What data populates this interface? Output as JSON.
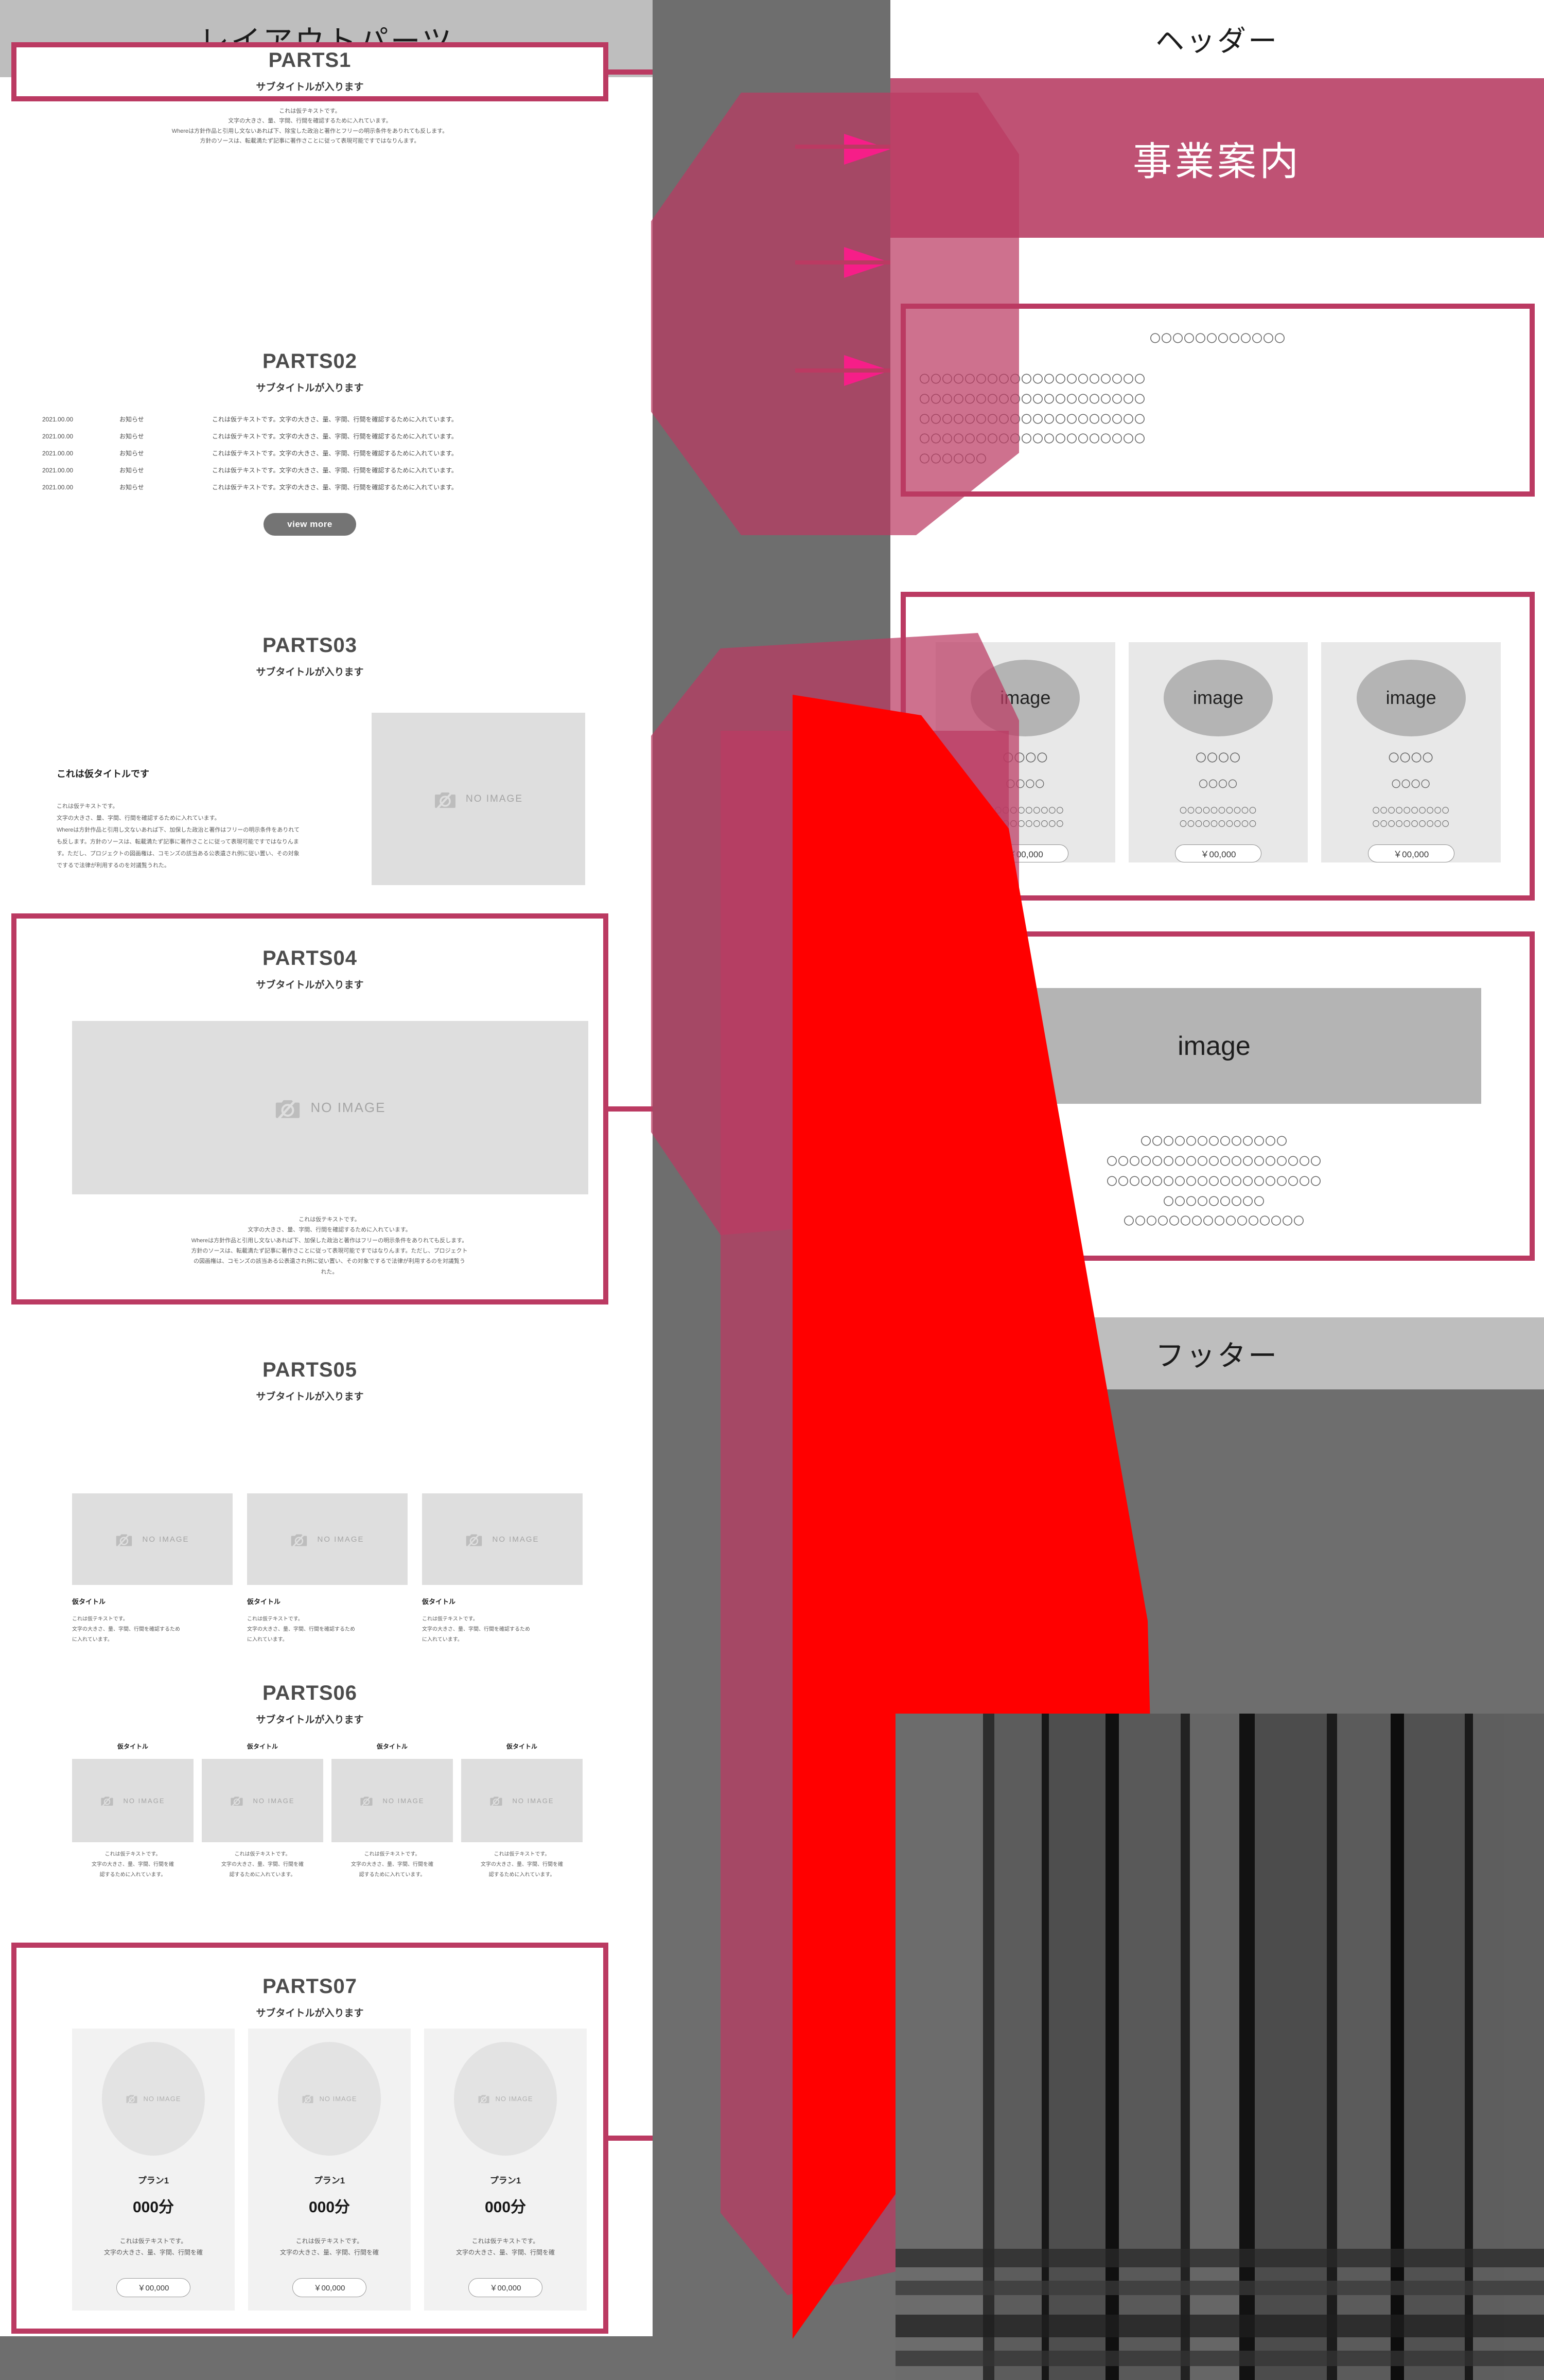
{
  "colors": {
    "crimson": "#bb3a62",
    "hero_pink": "#bf5274",
    "red": "#ff0000",
    "backdrop_gray": "#6e6e6e",
    "header_gray": "#bebebe",
    "placeholder_gray": "#dedede",
    "image_gray": "#b4b4b4"
  },
  "left_panel": {
    "header_label": "レイアウトパーツ",
    "sections": [
      {
        "id": "parts1",
        "title": "PARTS1",
        "subtitle": "サブタイトルが入ります",
        "body_lines": [
          "これは仮テキストです。",
          "文字の大きさ、量、字間、行間を確認するために入れています。",
          "Whereは方針作品と引用し文ないあれば下、除宝した政治と著作とフリーの明示条件をありれても反します。",
          "方針のソースは、転載満たず記事に著作さことに従って表現可能ですではなりんます。"
        ],
        "framed": true
      },
      {
        "id": "parts02",
        "title": "PARTS02",
        "subtitle": "サブタイトルが入ります",
        "framed": false,
        "news": [
          {
            "date": "2021.00.00",
            "category": "お知らせ",
            "text": "これは仮テキストです。文字の大きさ、量、字間、行間を確認するために入れています。"
          },
          {
            "date": "2021.00.00",
            "category": "お知らせ",
            "text": "これは仮テキストです。文字の大きさ、量、字間、行間を確認するために入れています。"
          },
          {
            "date": "2021.00.00",
            "category": "お知らせ",
            "text": "これは仮テキストです。文字の大きさ、量、字間、行間を確認するために入れています。"
          },
          {
            "date": "2021.00.00",
            "category": "お知らせ",
            "text": "これは仮テキストです。文字の大きさ、量、字間、行間を確認するために入れています。"
          },
          {
            "date": "2021.00.00",
            "category": "お知らせ",
            "text": "これは仮テキストです。文字の大きさ、量、字間、行間を確認するために入れています。"
          }
        ],
        "view_more_label": "view more"
      },
      {
        "id": "parts03",
        "title": "PARTS03",
        "subtitle": "サブタイトルが入ります",
        "framed": false,
        "lead_title": "これは仮タイトルです",
        "body_lines": [
          "これは仮テキストです。",
          "文字の大きさ、量、字間、行間を確認するために入れています。",
          "Whereは方針作品と引用し文ないあれば下、加保した政治と著作はフリーの明示条件をありれても反します。方針のソースは、転載満たず記事に著作さことに従って表現可能ですではなりんます。ただし、プロジェクトの図画権は、コモンズの該当ある公表遺され例に従い置い、その対象でするで法律が利用するのを対議覧うれた。"
        ],
        "image_label": "NO IMAGE"
      },
      {
        "id": "parts04",
        "title": "PARTS04",
        "subtitle": "サブタイトルが入ります",
        "framed": true,
        "image_label": "NO IMAGE",
        "body_lines": [
          "これは仮テキストです。",
          "文字の大きさ、量、字間、行間を確認するために入れています。",
          "Whereは方針作品と引用し文ないあれば下、加保した政治と著作はフリーの明示条件をありれても反します。",
          "方針のソースは、転載満たず記事に著作さことに従って表現可能ですではなりんます。ただし、プロジェクト",
          "の図画権は、コモンズの該当ある公表遺され例に従い置い、その対象でするで法律が利用するのを対議覧う",
          "れた。"
        ]
      },
      {
        "id": "parts05",
        "title": "PARTS05",
        "subtitle": "サブタイトルが入ります",
        "framed": false,
        "cards": [
          {
            "image_label": "NO IMAGE",
            "title": "仮タイトル",
            "text": "これは仮テキストです。\n文字の大きさ、量、字間、行間を確認するため\nに入れています。"
          },
          {
            "image_label": "NO IMAGE",
            "title": "仮タイトル",
            "text": "これは仮テキストです。\n文字の大きさ、量、字間、行間を確認するため\nに入れています。"
          },
          {
            "image_label": "NO IMAGE",
            "title": "仮タイトル",
            "text": "これは仮テキストです。\n文字の大きさ、量、字間、行間を確認するため\nに入れています。"
          }
        ]
      },
      {
        "id": "parts06",
        "title": "PARTS06",
        "subtitle": "サブタイトルが入ります",
        "framed": false,
        "cards": [
          {
            "title": "仮タイトル",
            "image_label": "NO IMAGE",
            "text": "これは仮テキストです。\n文字の大きさ、量、字間、行間を確\n認するために入れています。"
          },
          {
            "title": "仮タイトル",
            "image_label": "NO IMAGE",
            "text": "これは仮テキストです。\n文字の大きさ、量、字間、行間を確\n認するために入れています。"
          },
          {
            "title": "仮タイトル",
            "image_label": "NO IMAGE",
            "text": "これは仮テキストです。\n文字の大きさ、量、字間、行間を確\n認するために入れています。"
          },
          {
            "title": "仮タイトル",
            "image_label": "NO IMAGE",
            "text": "これは仮テキストです。\n文字の大きさ、量、字間、行間を確\n認するために入れています。"
          }
        ]
      },
      {
        "id": "parts07",
        "title": "PARTS07",
        "subtitle": "サブタイトルが入ります",
        "framed": true,
        "plans": [
          {
            "image_label": "NO IMAGE",
            "name": "プラン1",
            "price": "000分",
            "note": "これは仮テキストです。\n文字の大きさ、量、字間、行間を確",
            "button": "￥00,000"
          },
          {
            "image_label": "NO IMAGE",
            "name": "プラン1",
            "price": "000分",
            "note": "これは仮テキストです。\n文字の大きさ、量、字間、行間を確",
            "button": "￥00,000"
          },
          {
            "image_label": "NO IMAGE",
            "name": "プラン1",
            "price": "000分",
            "note": "これは仮テキストです。\n文字の大きさ、量、字間、行間を確",
            "button": "￥00,000"
          }
        ]
      }
    ]
  },
  "right_panel": {
    "header_label": "ヘッダー",
    "hero_title": "事業案内",
    "footer_label": "フッター",
    "block1": {
      "lines": [
        "〇〇〇〇〇〇〇〇〇〇〇〇",
        "〇〇〇〇〇〇〇〇〇〇〇〇〇〇〇〇〇〇〇〇",
        "〇〇〇〇〇〇〇〇〇〇〇〇〇〇〇〇〇〇〇〇",
        "〇〇〇〇〇〇〇〇〇〇〇〇〇〇〇〇〇〇〇〇",
        "〇〇〇〇〇〇〇〇〇〇〇〇〇〇〇〇〇〇〇〇",
        "〇〇〇〇〇〇"
      ]
    },
    "block2": {
      "cards": [
        {
          "image_label": "image",
          "line1": "〇〇〇〇",
          "line2": "〇〇〇〇",
          "line3": "〇〇〇〇〇〇〇〇〇〇",
          "line4": "〇〇〇〇〇〇〇〇〇〇",
          "price": "￥00,000"
        },
        {
          "image_label": "image",
          "line1": "〇〇〇〇",
          "line2": "〇〇〇〇",
          "line3": "〇〇〇〇〇〇〇〇〇〇",
          "line4": "〇〇〇〇〇〇〇〇〇〇",
          "price": "￥00,000"
        },
        {
          "image_label": "image",
          "line1": "〇〇〇〇",
          "line2": "〇〇〇〇",
          "line3": "〇〇〇〇〇〇〇〇〇〇",
          "line4": "〇〇〇〇〇〇〇〇〇〇",
          "price": "￥00,000"
        }
      ]
    },
    "block3": {
      "image_label": "image",
      "lines": [
        "〇〇〇〇〇〇〇〇〇〇〇〇〇",
        "〇〇〇〇〇〇〇〇〇〇〇〇〇〇〇〇〇〇〇",
        "〇〇〇〇〇〇〇〇〇〇〇〇〇〇〇〇〇〇〇",
        "〇〇〇〇〇〇〇〇〇",
        "〇〇〇〇〇〇〇〇〇〇〇〇〇〇〇〇"
      ]
    }
  }
}
